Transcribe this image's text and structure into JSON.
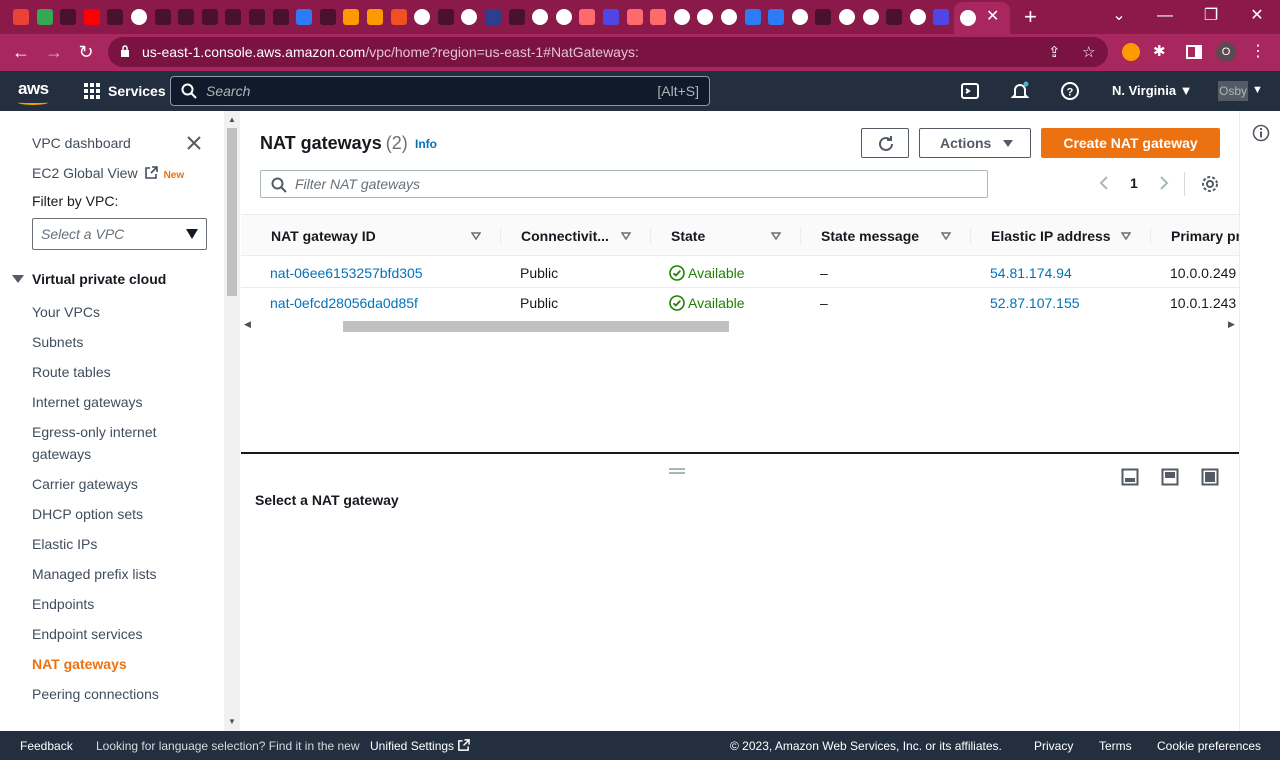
{
  "browser": {
    "tab_icons": [
      "#ea4335",
      "#34a853",
      "#4a1030",
      "#ff0000",
      "#4a1030",
      "#ffffff",
      "#4a1030",
      "#4a1030",
      "#4a1030",
      "#4a1030",
      "#4a1030",
      "#4a1030",
      "#2f7bf5",
      "#4a1030",
      "#ff9900",
      "#ff9900",
      "#f25022",
      "#ffffff",
      "#4a1030",
      "#ffffff",
      "#2c3e8f",
      "#4a1030",
      "#ffffff",
      "#ffffff",
      "#ff6b6b",
      "#4f46e5",
      "#ff6b6b",
      "#ff6b6b",
      "#ffffff",
      "#ffffff",
      "#ffffff",
      "#2f7bf5",
      "#2f7bf5",
      "#ffffff",
      "#4a1030",
      "#ffffff",
      "#ffffff",
      "#4a1030",
      "#ffffff",
      "#4f46e5",
      "#ffffff"
    ],
    "tab_close": "✕",
    "new_tab": "+",
    "url_main": "us-east-1.console.aws.amazon.com",
    "url_suffix": "/vpc/home?region=us-east-1#NatGateways:",
    "profile_initial": "O"
  },
  "aws_nav": {
    "logo": "aws",
    "services": "Services",
    "search_placeholder": "Search",
    "search_shortcut": "[Alt+S]",
    "region": "N. Virginia ▼",
    "user": "Osby"
  },
  "sidebar": {
    "vpc_dashboard": "VPC dashboard",
    "ec2_global_view": "EC2 Global View",
    "new_badge": "New",
    "filter_label": "Filter by VPC:",
    "filter_placeholder": "Select a VPC",
    "section": "Virtual private cloud",
    "items": [
      "Your VPCs",
      "Subnets",
      "Route tables",
      "Internet gateways",
      "Egress-only internet",
      "gateways",
      "Carrier gateways",
      "DHCP option sets",
      "Elastic IPs",
      "Managed prefix lists",
      "Endpoints",
      "Endpoint services",
      "NAT gateways",
      "Peering connections"
    ]
  },
  "main": {
    "title": "NAT gateways",
    "count": "(2)",
    "info": "Info",
    "actions": "Actions",
    "create": "Create NAT gateway",
    "filter_placeholder": "Filter NAT gateways",
    "page": "1",
    "columns": [
      "NAT gateway ID",
      "Connectivit...",
      "State",
      "State message",
      "Elastic IP address",
      "Primary pr"
    ],
    "rows": [
      {
        "id": "nat-06ee6153257bfd305",
        "conn": "Public",
        "state": "Available",
        "msg": "–",
        "eip": "54.81.174.94",
        "pip": "10.0.0.249"
      },
      {
        "id": "nat-0efcd28056da0d85f",
        "conn": "Public",
        "state": "Available",
        "msg": "–",
        "eip": "52.87.107.155",
        "pip": "10.0.1.243"
      }
    ],
    "split_title": "Select a NAT gateway"
  },
  "footer": {
    "feedback": "Feedback",
    "lang_text": "Looking for language selection? Find it in the new",
    "unified": "Unified Settings",
    "copyright": "© 2023, Amazon Web Services, Inc. or its affiliates.",
    "privacy": "Privacy",
    "terms": "Terms",
    "cookies": "Cookie preferences"
  },
  "colors": {
    "browser_frame": "#8b1a4a",
    "aws_nav": "#232f3e",
    "accent": "#ec7211",
    "link": "#0073bb",
    "success": "#1d8102"
  }
}
